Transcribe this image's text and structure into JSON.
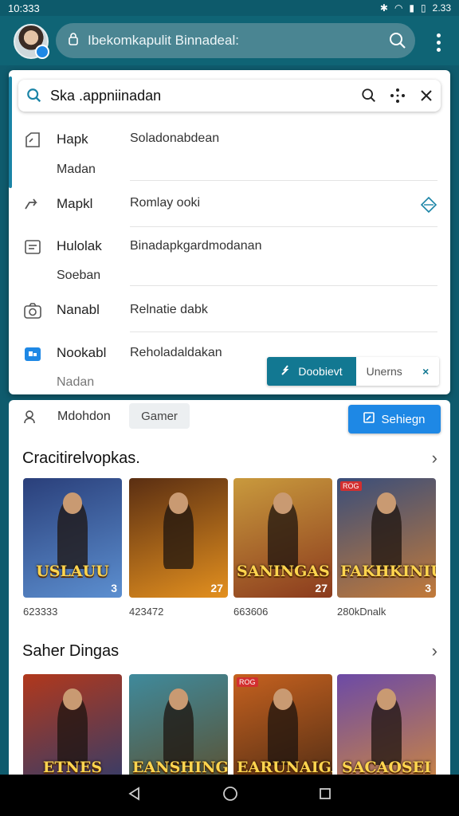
{
  "status": {
    "time": "10:333",
    "battery": "2.33"
  },
  "topbar": {
    "search_text": "Ibekomkapulit Binnadeal:"
  },
  "panel": {
    "search_value": "Ska .appniinadan",
    "rows": [
      {
        "label": "Hapk",
        "sub": "Madan",
        "value": "Soladonabdean"
      },
      {
        "label": "Mapkl",
        "sub": "",
        "value": "Romlay ooki"
      },
      {
        "label": "Hulolak",
        "sub": "Soeban",
        "value": "Binadapkgardmodanan"
      },
      {
        "label": "Nanabl",
        "sub": "",
        "value": "Relnatie dabk"
      },
      {
        "label": "Nookabl",
        "sub": "Nadan",
        "value": "Reholadaldakan"
      }
    ],
    "action_primary": "Doobievt",
    "action_secondary": "Unerns",
    "action_close": "×"
  },
  "filters": {
    "label": "Mdohdon",
    "chip": "Gamer",
    "cta": "Sehiegn"
  },
  "sections": [
    {
      "title": "Cracitirelvopkas.",
      "items": [
        {
          "title": "USLAUU",
          "tag": "3",
          "price": "623333",
          "colors": [
            "#2a3f7a",
            "#5c8fd0"
          ]
        },
        {
          "title": "",
          "tag": "27",
          "price": "423472",
          "colors": [
            "#5a2e12",
            "#e3901f"
          ]
        },
        {
          "title": "SANINGAS",
          "tag": "27",
          "price": "663606",
          "colors": [
            "#c99a3d",
            "#8b3a1d"
          ]
        },
        {
          "title": "FAKHKINIU",
          "tag": "3",
          "price": "280kDnalk",
          "badge": "ROG",
          "colors": [
            "#3a4e7a",
            "#c27a3a"
          ]
        }
      ]
    },
    {
      "title": "Saher Dingas",
      "items": [
        {
          "title": "ETNES",
          "tag": "",
          "price": "",
          "colors": [
            "#b1381c",
            "#2d3d6e"
          ]
        },
        {
          "title": "EANSHING",
          "tag": "",
          "price": "",
          "colors": [
            "#3f8a9c",
            "#5d4d2a"
          ]
        },
        {
          "title": "EARUNAIGA",
          "tag": "",
          "price": "",
          "badge": "ROG",
          "colors": [
            "#c5611f",
            "#4a2a14"
          ]
        },
        {
          "title": "SACAOSEI",
          "tag": "",
          "price": "",
          "colors": [
            "#6c4aa6",
            "#d0893c"
          ]
        }
      ]
    }
  ]
}
